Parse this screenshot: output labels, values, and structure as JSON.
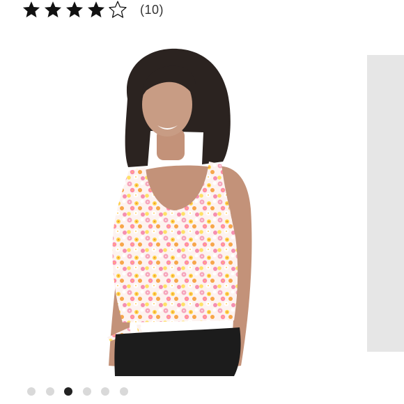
{
  "rating": {
    "stars_filled": 4,
    "stars_total": 5,
    "review_count_text": "(10)"
  },
  "icons": {
    "star_filled": "filled-star-icon",
    "star_empty": "outline-star-icon"
  },
  "carousel": {
    "total_images": 6,
    "active_index": 2
  },
  "colors": {
    "star": "#111111",
    "active_dot": "#222222",
    "inactive_dot": "#d9d9d9",
    "peek_panel": "#e6e6e6"
  }
}
